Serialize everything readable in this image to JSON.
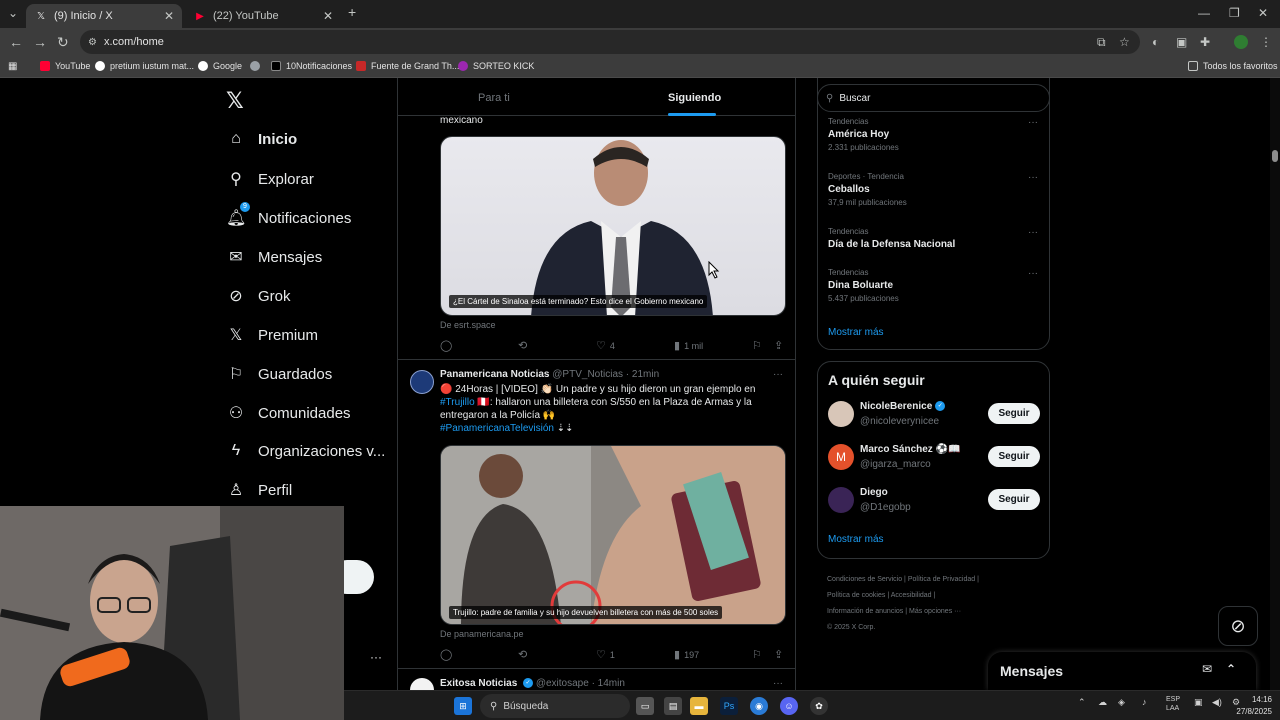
{
  "browser": {
    "tabs": [
      {
        "title": "(9) Inicio / X",
        "active": true
      },
      {
        "title": "(22) YouTube",
        "active": false
      }
    ],
    "new_tab": "+",
    "url": "x.com/home",
    "bookmarks": [
      "YouTube",
      "pretium iustum mat...",
      "Google",
      "10Notificaciones",
      "Fuente de Grand Th...",
      "SORTEO KICK"
    ],
    "all_bookmarks": "Todos los favoritos"
  },
  "sidebar": {
    "items": [
      {
        "label": "Inicio",
        "icon": "home-icon"
      },
      {
        "label": "Explorar",
        "icon": "search-icon"
      },
      {
        "label": "Notificaciones",
        "icon": "bell-icon",
        "badge": "9"
      },
      {
        "label": "Mensajes",
        "icon": "envelope-icon"
      },
      {
        "label": "Grok",
        "icon": "grok-icon"
      },
      {
        "label": "Premium",
        "icon": "x-icon"
      },
      {
        "label": "Guardados",
        "icon": "bookmark-icon"
      },
      {
        "label": "Comunidades",
        "icon": "people-icon"
      },
      {
        "label": "Organizaciones v...",
        "icon": "lightning-icon"
      },
      {
        "label": "Perfil",
        "icon": "person-icon"
      }
    ]
  },
  "feed": {
    "tabs": {
      "for_you": "Para ti",
      "following": "Siguiendo"
    },
    "post1": {
      "text_tail": "mexicano",
      "caption": "¿El Cártel de Sinaloa está terminado? Esto dice el Gobierno mexicano",
      "source": "De esrt.space",
      "likes": "4",
      "views": "1 mil"
    },
    "post2": {
      "name": "Panamericana Noticias",
      "handle": "@PTV_Noticias · 21min",
      "line1": "🔴 24Horas | [VIDEO] 👏🏻 Un padre y su hijo dieron un gran ejemplo en",
      "line2_link": "#Trujillo",
      "line2_rest": " 🇵🇪: hallaron una billetera con S/550 en la Plaza de Armas y la",
      "line3": "entregaron a la Policía 🙌",
      "hashtag": "#PanamericanaTelevisión",
      "arrows": " ⇣⇣",
      "caption": "Trujillo: padre de familia y su hijo devuelven billetera con más de 500 soles",
      "source": "De panamericana.pe",
      "likes": "1",
      "views": "197"
    },
    "post3": {
      "name": "Exitosa Noticias",
      "handle": "@exitosape · 14min"
    }
  },
  "right": {
    "search_placeholder": "Buscar",
    "trends": [
      {
        "meta": "Tendencias",
        "title": "América Hoy",
        "count": "2.331 publicaciones"
      },
      {
        "meta": "Deportes · Tendencia",
        "title": "Ceballos",
        "count": "37,9 mil publicaciones"
      },
      {
        "meta": "Tendencias",
        "title": "Día de la Defensa Nacional",
        "count": ""
      },
      {
        "meta": "Tendencias",
        "title": "Dina Boluarte",
        "count": "5.437 publicaciones"
      }
    ],
    "show_more": "Mostrar más",
    "who_to_follow": {
      "title": "A quién seguir",
      "users": [
        {
          "name": "NicoleBerenice",
          "handle": "@nicoleverynicee",
          "verified": true
        },
        {
          "name": "Marco Sánchez ⚽📖",
          "handle": "@igarza_marco",
          "verified": false
        },
        {
          "name": "Diego",
          "handle": "@D1egobp",
          "verified": false
        }
      ],
      "follow_label": "Seguir",
      "show_more": "Mostrar más"
    },
    "footer": {
      "l1": "Condiciones de Servicio",
      "l2": "Política de Privacidad",
      "l3": "Política de cookies",
      "l4": "Accesibilidad",
      "l5": "Información de anuncios",
      "l6": "Más opciones ···",
      "l7": "© 2025 X Corp."
    },
    "messages": "Mensajes"
  },
  "taskbar": {
    "search": "Búsqueda",
    "lang1": "ESP",
    "lang2": "LAA",
    "time": "14:16",
    "date": "27/8/2025"
  }
}
